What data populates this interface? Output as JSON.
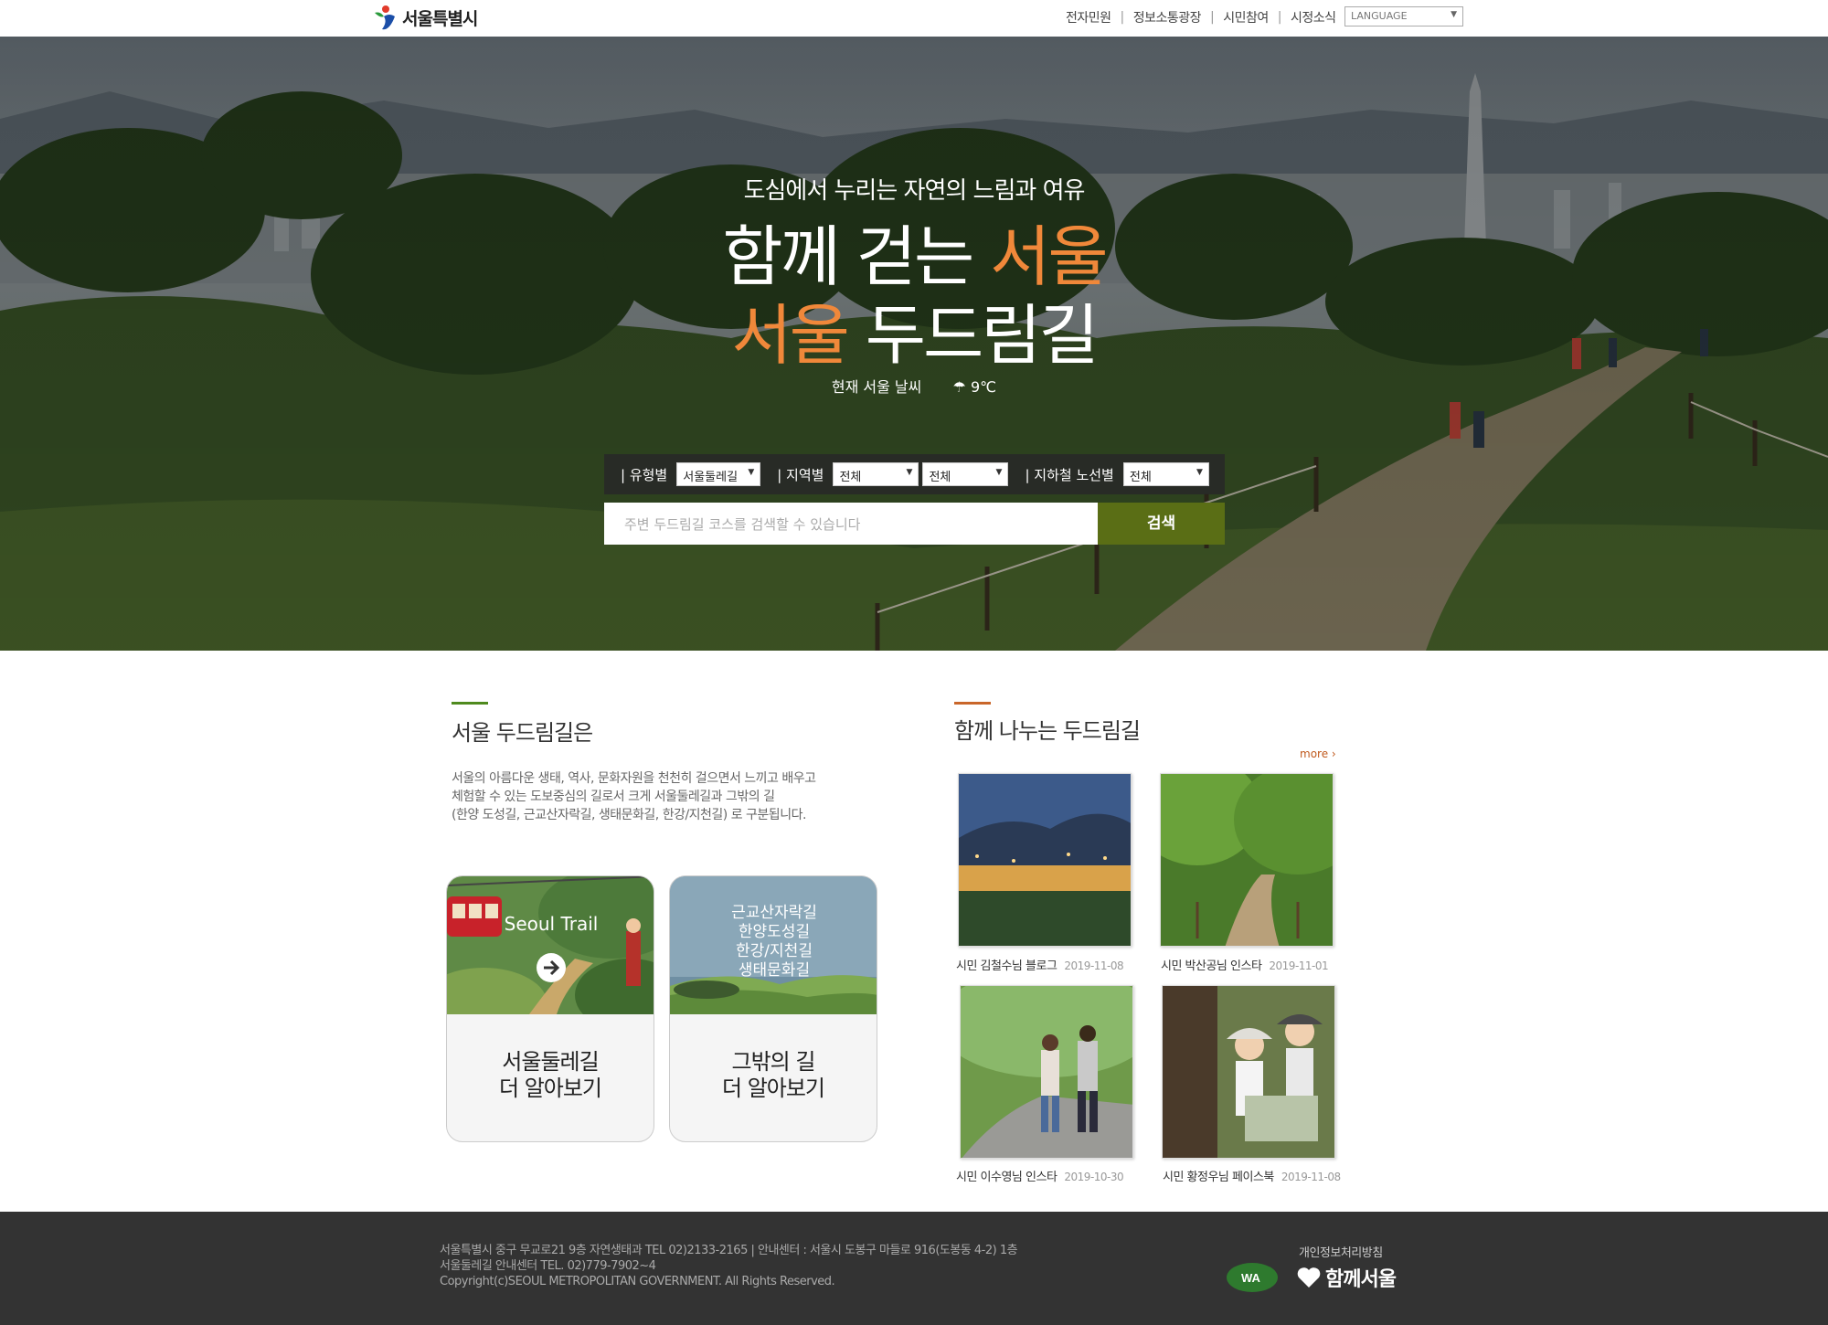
{
  "header": {
    "logo_text": "서울특별시",
    "nav": [
      "전자민원",
      "정보소통광장",
      "시민참여",
      "시정소식"
    ],
    "language_select": "LANGUAGE"
  },
  "hero": {
    "subtitle": "도심에서 누리는 자연의 느림과 여유",
    "title1_white": "함께 걷는 ",
    "title1_orange": "서울",
    "title2_orange": "서울",
    "title2_white": " 두드림길",
    "weather_label": "현재 서울 날씨",
    "weather_value": "9℃"
  },
  "search": {
    "type_label": "| 유형별",
    "type_value": "서울둘레길",
    "region_label": "| 지역별",
    "region_value1": "전체",
    "region_value2": "전체",
    "subway_label": "| 지하철 노선별",
    "subway_value": "전체",
    "placeholder": "주변 두드림길 코스를 검색할 수 있습니다",
    "button": "검색"
  },
  "about": {
    "title": "서울 두드림길은",
    "text_lines": [
      "서울의 아름다운 생태, 역사, 문화자원을 천천히 걸으면서 느끼고 배우고",
      "체험할 수 있는 도보중심의 길로서 크게 서울둘레길과 그밖의 길",
      "(한양 도성길, 근교산자락길, 생태문화길, 한강/지천길) 로 구분됩니다."
    ],
    "card1": {
      "image_label": "Seoul Trail",
      "line1": "서울둘레길",
      "line2": "더 알아보기"
    },
    "card2": {
      "image_lines": [
        "근교산자락길",
        "한양도성길",
        "한강/지천길",
        "생태문화길"
      ],
      "line1": "그밖의 길",
      "line2": "더 알아보기"
    }
  },
  "share": {
    "title": "함께 나누는 두드림길",
    "more": "more",
    "items": [
      {
        "caption": "시민 김철수님 블로그",
        "date": "2019-11-08"
      },
      {
        "caption": "시민 박산공님 인스타",
        "date": "2019-11-01"
      },
      {
        "caption": "시민 이수영님 인스타",
        "date": "2019-10-30"
      },
      {
        "caption": "시민 황정우님 페이스북",
        "date": "2019-11-08"
      }
    ]
  },
  "footer": {
    "address_lines": [
      "서울특별시 중구 무교로21 9층 자연생태과 TEL 02)2133-2165 | 안내센터 : 서울시 도봉구 마들로 916(도봉동 4-2) 1층",
      "서울둘레길 안내센터 TEL. 02)779-7902~4",
      "Copyright(c)SEOUL METROPOLITAN GOVERNMENT. All Rights Reserved."
    ],
    "privacy": "개인정보처리방침",
    "wa_mark": "WA",
    "together_logo": "함께서울"
  },
  "colors": {
    "accent_orange": "#f0883a",
    "search_green": "#5a6e15",
    "section_bar_green": "#4f8a1e",
    "section_bar_orange": "#c9662a",
    "footer_bg": "#333333"
  }
}
